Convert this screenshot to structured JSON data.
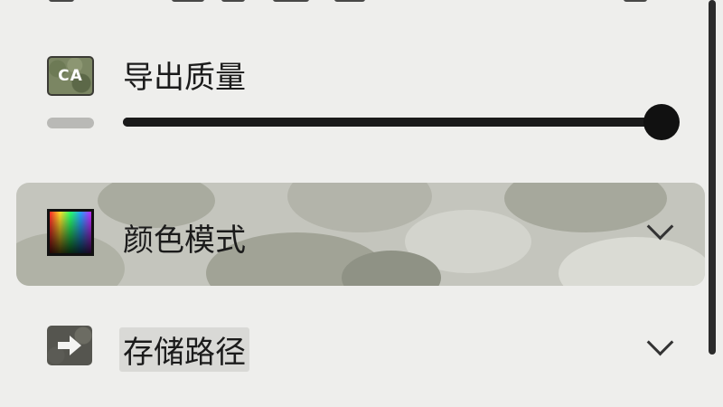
{
  "settings": {
    "quality": {
      "icon": "camo-ca-icon",
      "icon_text": "CA",
      "label": "导出质量",
      "slider_value": 1.0
    },
    "color_mode": {
      "icon": "color-palette-icon",
      "label": "颜色模式",
      "expand_icon": "chevron-down-icon"
    },
    "save_path": {
      "icon": "arrow-right-icon",
      "label": "存储路径",
      "expand_icon": "chevron-down-icon"
    }
  },
  "colors": {
    "background": "#eeeeec",
    "text": "#1b1b1b",
    "slider": "#1a1a1a",
    "highlight": "#c4c5bd"
  }
}
